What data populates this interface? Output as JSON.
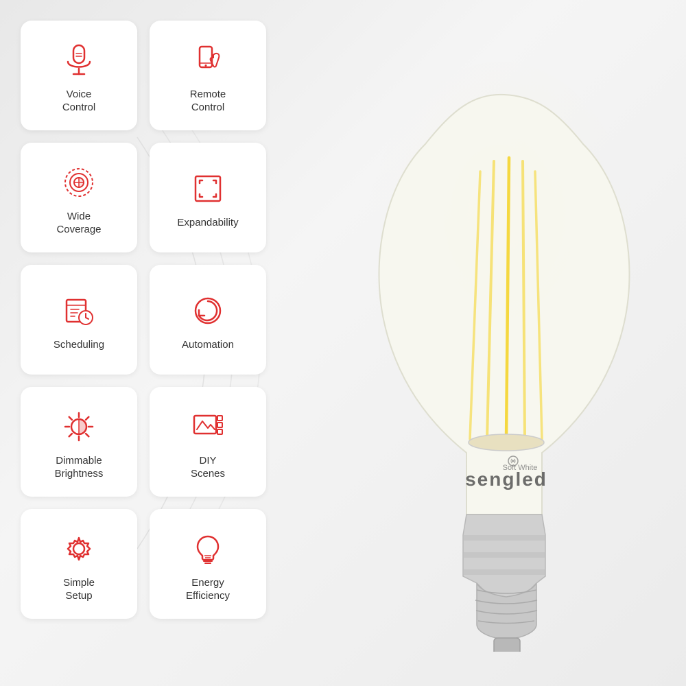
{
  "background": {
    "color_start": "#e8e8e8",
    "color_end": "#f5f5f5"
  },
  "features": [
    {
      "id": "voice-control",
      "label": "Voice\nControl",
      "icon": "microphone"
    },
    {
      "id": "remote-control",
      "label": "Remote\nControl",
      "icon": "phone-touch"
    },
    {
      "id": "wide-coverage",
      "label": "Wide\nCoverage",
      "icon": "wifi-signal"
    },
    {
      "id": "expandability",
      "label": "Expandability",
      "icon": "expand-arrows"
    },
    {
      "id": "scheduling",
      "label": "Scheduling",
      "icon": "calendar-clock"
    },
    {
      "id": "automation",
      "label": "Automation",
      "icon": "refresh-circle"
    },
    {
      "id": "dimmable-brightness",
      "label": "Dimmable\nBrightness",
      "icon": "sun-half"
    },
    {
      "id": "diy-scenes",
      "label": "DIY\nScenes",
      "icon": "image-grid"
    },
    {
      "id": "simple-setup",
      "label": "Simple\nSetup",
      "icon": "gear"
    },
    {
      "id": "energy-efficiency",
      "label": "Energy\nEfficiency",
      "icon": "lightbulb"
    }
  ],
  "brand": {
    "name": "sengled",
    "subtitle": "Soft White"
  },
  "accent_color": "#e03030"
}
